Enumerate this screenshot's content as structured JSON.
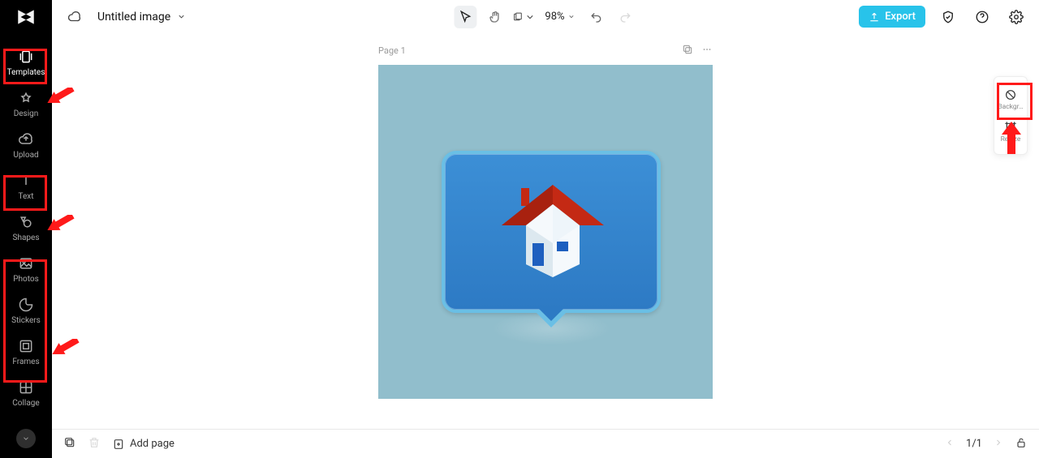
{
  "app_title": "Untitled image",
  "topbar": {
    "export_label": "Export",
    "zoom_value": "98%",
    "title_dropdown_icon": "chevron-down"
  },
  "sidebar": {
    "items": [
      {
        "key": "templates",
        "label": "Templates"
      },
      {
        "key": "design",
        "label": "Design"
      },
      {
        "key": "upload",
        "label": "Upload"
      },
      {
        "key": "text",
        "label": "Text"
      },
      {
        "key": "shapes",
        "label": "Shapes"
      },
      {
        "key": "photos",
        "label": "Photos"
      },
      {
        "key": "stickers",
        "label": "Stickers"
      },
      {
        "key": "frames",
        "label": "Frames"
      },
      {
        "key": "collage",
        "label": "Collage"
      }
    ]
  },
  "page": {
    "label": "Page 1"
  },
  "rightpanel": {
    "items": [
      {
        "key": "background",
        "label": "Backgr…"
      },
      {
        "key": "resize",
        "label": "Resize"
      }
    ]
  },
  "bottombar": {
    "add_page": "Add page",
    "page_indicator": "1/1"
  },
  "colors": {
    "canvas_bg": "#91becc",
    "bubble_gradient_top": "#3c8fd6",
    "bubble_gradient_bottom": "#2d7ac4",
    "bubble_border": "#6abfe5",
    "roof": "#c42914",
    "door": "#1e5fbf",
    "export_button": "#28c3ea",
    "highlight_red": "#ff1a1a"
  },
  "annotations": {
    "highlight_sidebar_items": [
      "templates",
      "text",
      "photos",
      "stickers",
      "frames"
    ],
    "highlight_rightpanel_items": [
      "resize"
    ],
    "arrows": [
      {
        "target": "templates",
        "dir": "left"
      },
      {
        "target": "text",
        "dir": "left"
      },
      {
        "target": "photos",
        "dir": "left"
      },
      {
        "target": "resize",
        "dir": "up"
      }
    ]
  }
}
